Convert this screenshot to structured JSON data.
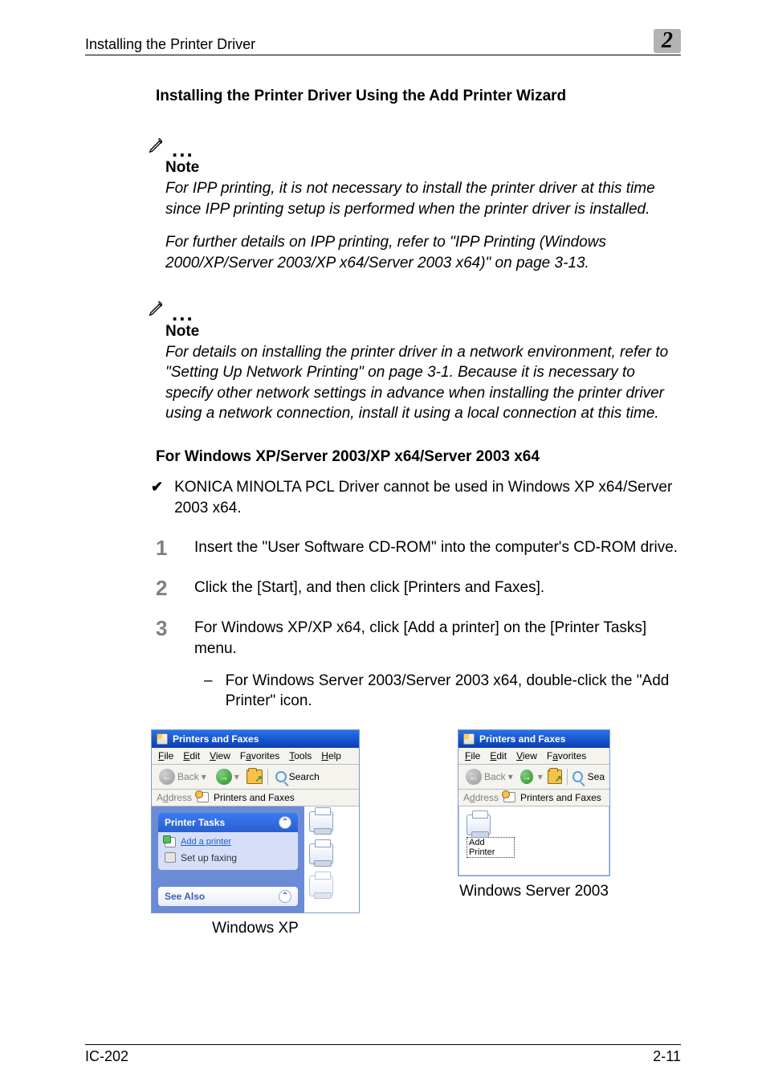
{
  "header": {
    "title": "Installing the Printer Driver",
    "chapter": "2"
  },
  "section_heading": "Installing the Printer Driver Using the Add Printer Wizard",
  "note1": {
    "label": "Note",
    "paras": [
      "For IPP printing, it is not necessary to install the printer driver at this time since IPP printing setup is performed when the printer driver is installed.",
      "For further details on IPP printing, refer to \"IPP Printing (Windows 2000/XP/Server 2003/XP x64/Server 2003 x64)\" on page 3-13."
    ]
  },
  "note2": {
    "label": "Note",
    "paras": [
      "For details on installing the printer driver in a network environment, refer to \"Setting Up Network Printing\" on page 3-1. Because it is necessary to specify other network settings in advance when installing the printer driver using a network connection, install it using a local connection at this time."
    ]
  },
  "subsection_heading": "For Windows XP/Server 2003/XP x64/Server 2003 x64",
  "bullet": "KONICA MINOLTA PCL Driver cannot be used in Windows XP x64/Server 2003 x64.",
  "steps": [
    {
      "num": "1",
      "text": "Insert the \"User Software CD-ROM\" into the computer's CD-ROM drive."
    },
    {
      "num": "2",
      "text": "Click the [Start], and then click [Printers and Faxes]."
    },
    {
      "num": "3",
      "text": "For Windows XP/XP x64, click [Add a printer] on the [Printer Tasks] menu.",
      "sub": "For Windows Server 2003/Server 2003 x64, double-click the \"Add Printer\" icon."
    }
  ],
  "xp": {
    "window_title": "Printers and Faxes",
    "menus": {
      "file": "File",
      "edit": "Edit",
      "view": "View",
      "favorites": "Favorites",
      "tools": "Tools",
      "help": "Help"
    },
    "toolbar": {
      "back": "Back",
      "search": "Search",
      "sea": "Sea"
    },
    "address": {
      "label": "Address",
      "value": "Printers and Faxes"
    },
    "tasks": {
      "header": "Printer Tasks",
      "add_printer": "Add a printer",
      "set_up_faxing": "Set up faxing",
      "see_also": "See Also"
    },
    "add_printer_icon_label": "Add Printer"
  },
  "captions": {
    "left": "Windows XP",
    "right": "Windows Server 2003"
  },
  "footer": {
    "left": "IC-202",
    "right": "2-11"
  }
}
